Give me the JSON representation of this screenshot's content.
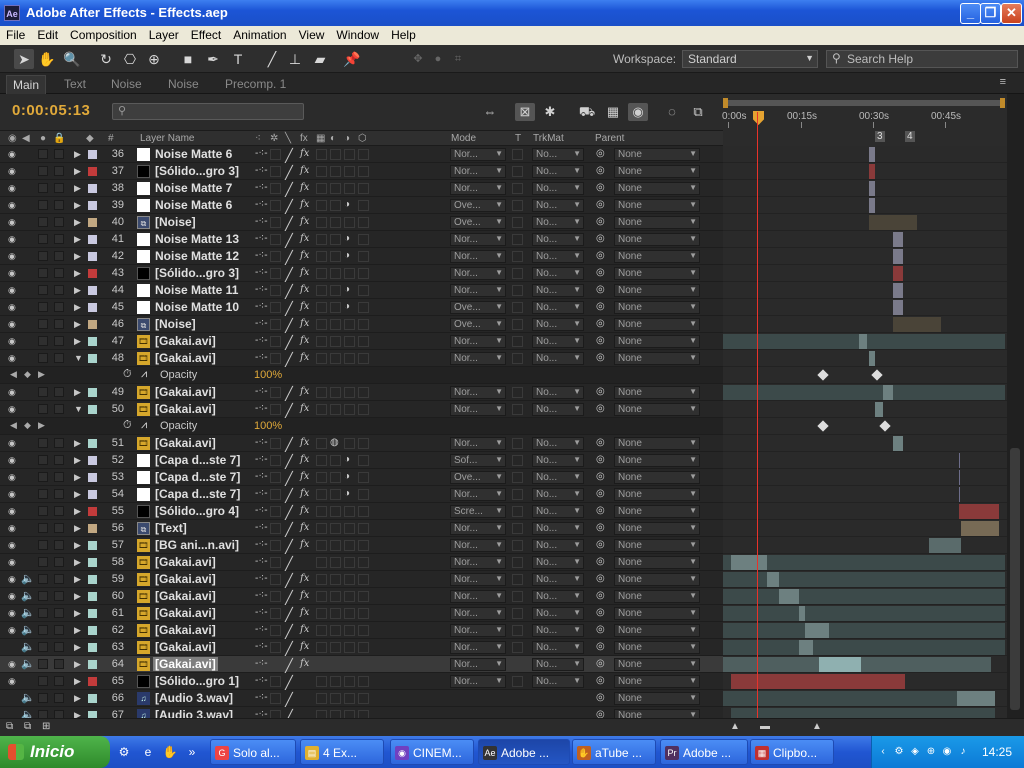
{
  "window": {
    "title": "Adobe After Effects - Effects.aep",
    "app_icon": "Ae"
  },
  "menu": [
    "File",
    "Edit",
    "Composition",
    "Layer",
    "Effect",
    "Animation",
    "View",
    "Window",
    "Help"
  ],
  "toolbar": {
    "workspace_label": "Workspace:",
    "workspace_value": "Standard",
    "search_placeholder": "Search Help"
  },
  "tabs": [
    "Main",
    "Text",
    "Noise",
    "Noise",
    "Precomp. 1"
  ],
  "active_tab": 0,
  "timecode": "0:00:05:13",
  "columns": {
    "layer_name": "Layer Name",
    "mode": "Mode",
    "t": "T",
    "trkmat": "TrkMat",
    "parent": "Parent",
    "hash": "#"
  },
  "ruler": {
    "ticks": [
      "0:00s",
      "00:15s",
      "00:30s",
      "00:45s"
    ],
    "markers": [
      "3",
      "4"
    ]
  },
  "colors": {
    "cti": "#e8322a",
    "timecode": "#e0a93a",
    "accent_orange": "#e5a331"
  },
  "layers": [
    {
      "num": "36",
      "name": "Noise Matte 6",
      "label": "#c9c9e0",
      "src": "white",
      "mode": "Nor...",
      "trk": "No...",
      "parent": "None",
      "fx": true,
      "blend": false,
      "eye": true,
      "audio": false
    },
    {
      "num": "37",
      "name": "[Sólido...gro 3]",
      "label": "#c23b3b",
      "src": "black",
      "mode": "Nor...",
      "trk": "No...",
      "parent": "None",
      "fx": true,
      "blend": false,
      "eye": true,
      "audio": false
    },
    {
      "num": "38",
      "name": "Noise Matte 7",
      "label": "#c9c9e0",
      "src": "white",
      "mode": "Nor...",
      "trk": "No...",
      "parent": "None",
      "fx": true,
      "blend": false,
      "eye": true,
      "audio": false
    },
    {
      "num": "39",
      "name": "Noise Matte 6",
      "label": "#c9c9e0",
      "src": "white",
      "mode": "Ove...",
      "trk": "No...",
      "parent": "None",
      "fx": true,
      "blend": true,
      "eye": true,
      "audio": false
    },
    {
      "num": "40",
      "name": "[Noise]",
      "label": "#c2a882",
      "src": "comp",
      "mode": "Ove...",
      "trk": "No...",
      "parent": "None",
      "fx": true,
      "blend": false,
      "eye": true,
      "audio": false
    },
    {
      "num": "41",
      "name": "Noise Matte 13",
      "label": "#c9c9e0",
      "src": "white",
      "mode": "Nor...",
      "trk": "No...",
      "parent": "None",
      "fx": true,
      "blend": true,
      "eye": true,
      "audio": false
    },
    {
      "num": "42",
      "name": "Noise Matte 12",
      "label": "#c9c9e0",
      "src": "white",
      "mode": "Nor...",
      "trk": "No...",
      "parent": "None",
      "fx": true,
      "blend": true,
      "eye": true,
      "audio": false
    },
    {
      "num": "43",
      "name": "[Sólido...gro 3]",
      "label": "#c23b3b",
      "src": "black",
      "mode": "Nor...",
      "trk": "No...",
      "parent": "None",
      "fx": true,
      "blend": false,
      "eye": true,
      "audio": false
    },
    {
      "num": "44",
      "name": "Noise Matte 11",
      "label": "#c9c9e0",
      "src": "white",
      "mode": "Nor...",
      "trk": "No...",
      "parent": "None",
      "fx": true,
      "blend": true,
      "eye": true,
      "audio": false
    },
    {
      "num": "45",
      "name": "Noise Matte 10",
      "label": "#c9c9e0",
      "src": "white",
      "mode": "Ove...",
      "trk": "No...",
      "parent": "None",
      "fx": true,
      "blend": true,
      "eye": true,
      "audio": false
    },
    {
      "num": "46",
      "name": "[Noise]",
      "label": "#c2a882",
      "src": "comp",
      "mode": "Ove...",
      "trk": "No...",
      "parent": "None",
      "fx": true,
      "blend": false,
      "eye": true,
      "audio": false
    },
    {
      "num": "47",
      "name": "[Gakai.avi]",
      "label": "#a9d4cc",
      "src": "avi",
      "mode": "Nor...",
      "trk": "No...",
      "parent": "None",
      "fx": true,
      "blend": false,
      "eye": true,
      "audio": false
    },
    {
      "num": "48",
      "name": "[Gakai.avi]",
      "label": "#a9d4cc",
      "src": "avi",
      "mode": "Nor...",
      "trk": "No...",
      "parent": "None",
      "fx": true,
      "blend": false,
      "eye": true,
      "audio": false,
      "expanded": true,
      "prop": {
        "name": "Opacity",
        "value": "100%"
      }
    },
    {
      "num": "49",
      "name": "[Gakai.avi]",
      "label": "#a9d4cc",
      "src": "avi",
      "mode": "Nor...",
      "trk": "No...",
      "parent": "None",
      "fx": true,
      "blend": false,
      "eye": true,
      "audio": false
    },
    {
      "num": "50",
      "name": "[Gakai.avi]",
      "label": "#a9d4cc",
      "src": "avi",
      "mode": "Nor...",
      "trk": "No...",
      "parent": "None",
      "fx": true,
      "blend": false,
      "eye": true,
      "audio": false,
      "expanded": true,
      "prop": {
        "name": "Opacity",
        "value": "100%"
      }
    },
    {
      "num": "51",
      "name": "[Gakai.avi]",
      "label": "#a9d4cc",
      "src": "avi",
      "mode": "Nor...",
      "trk": "No...",
      "parent": "None",
      "fx": true,
      "blend": false,
      "eye": true,
      "audio": false,
      "motionblur": true
    },
    {
      "num": "52",
      "name": "[Capa d...ste 7]",
      "label": "#c9c9e0",
      "src": "white",
      "mode": "Sof...",
      "trk": "No...",
      "parent": "None",
      "fx": true,
      "blend": true,
      "eye": true,
      "audio": false
    },
    {
      "num": "53",
      "name": "[Capa d...ste 7]",
      "label": "#c9c9e0",
      "src": "white",
      "mode": "Ove...",
      "trk": "No...",
      "parent": "None",
      "fx": true,
      "blend": true,
      "eye": true,
      "audio": false
    },
    {
      "num": "54",
      "name": "[Capa d...ste 7]",
      "label": "#c9c9e0",
      "src": "white",
      "mode": "Nor...",
      "trk": "No...",
      "parent": "None",
      "fx": true,
      "blend": true,
      "eye": true,
      "audio": false
    },
    {
      "num": "55",
      "name": "[Sólido...gro 4]",
      "label": "#c23b3b",
      "src": "black",
      "mode": "Scre...",
      "trk": "No...",
      "parent": "None",
      "fx": true,
      "blend": false,
      "eye": true,
      "audio": false
    },
    {
      "num": "56",
      "name": "[Text]",
      "label": "#c2a882",
      "src": "comp",
      "mode": "Nor...",
      "trk": "No...",
      "parent": "None",
      "fx": true,
      "blend": false,
      "eye": true,
      "audio": false
    },
    {
      "num": "57",
      "name": "[BG ani...n.avi]",
      "label": "#a9d4cc",
      "src": "avi",
      "mode": "Nor...",
      "trk": "No...",
      "parent": "None",
      "fx": true,
      "blend": false,
      "eye": true,
      "audio": false
    },
    {
      "num": "58",
      "name": "[Gakai.avi]",
      "label": "#a9d4cc",
      "src": "avi",
      "mode": "Nor...",
      "trk": "No...",
      "parent": "None",
      "fx": false,
      "blend": false,
      "eye": true,
      "audio": false
    },
    {
      "num": "59",
      "name": "[Gakai.avi]",
      "label": "#a9d4cc",
      "src": "avi",
      "mode": "Nor...",
      "trk": "No...",
      "parent": "None",
      "fx": true,
      "blend": false,
      "eye": true,
      "audio": true
    },
    {
      "num": "60",
      "name": "[Gakai.avi]",
      "label": "#a9d4cc",
      "src": "avi",
      "mode": "Nor...",
      "trk": "No...",
      "parent": "None",
      "fx": true,
      "blend": false,
      "eye": true,
      "audio": true
    },
    {
      "num": "61",
      "name": "[Gakai.avi]",
      "label": "#a9d4cc",
      "src": "avi",
      "mode": "Nor...",
      "trk": "No...",
      "parent": "None",
      "fx": true,
      "blend": false,
      "eye": true,
      "audio": true
    },
    {
      "num": "62",
      "name": "[Gakai.avi]",
      "label": "#a9d4cc",
      "src": "avi",
      "mode": "Nor...",
      "trk": "No...",
      "parent": "None",
      "fx": true,
      "blend": false,
      "eye": true,
      "audio": true
    },
    {
      "num": "63",
      "name": "[Gakai.avi]",
      "label": "#a9d4cc",
      "src": "avi",
      "mode": "Nor...",
      "trk": "No...",
      "parent": "None",
      "fx": true,
      "blend": false,
      "eye": false,
      "audio": true
    },
    {
      "num": "64",
      "name": "[Gakai.avi]",
      "label": "#a9d4cc",
      "src": "avi",
      "mode": "Nor...",
      "trk": "No...",
      "parent": "None",
      "fx": true,
      "blend": false,
      "eye": true,
      "audio": true,
      "selected": true
    },
    {
      "num": "65",
      "name": "[Sólido...gro 1]",
      "label": "#c23b3b",
      "src": "black",
      "mode": "Nor...",
      "trk": "No...",
      "parent": "None",
      "fx": false,
      "blend": false,
      "eye": true,
      "audio": false
    },
    {
      "num": "66",
      "name": "[Audio 3.wav]",
      "label": "#a9d4cc",
      "src": "wav",
      "mode": "",
      "trk": "",
      "parent": "None",
      "fx": false,
      "blend": false,
      "eye": false,
      "audio": true
    },
    {
      "num": "67",
      "name": "[Audio 3.wav]",
      "label": "#a9d4cc",
      "src": "wav",
      "mode": "",
      "trk": "",
      "parent": "None",
      "fx": false,
      "blend": false,
      "eye": false,
      "audio": true
    }
  ],
  "taskbar": {
    "start_label": "Inicio",
    "buttons": [
      "Solo al...",
      "4 Ex...",
      "CINEM...",
      "Adobe ...",
      "aTube ...",
      "Adobe ...",
      "Clipbo..."
    ],
    "active_button": 3,
    "clock": "14:25"
  }
}
